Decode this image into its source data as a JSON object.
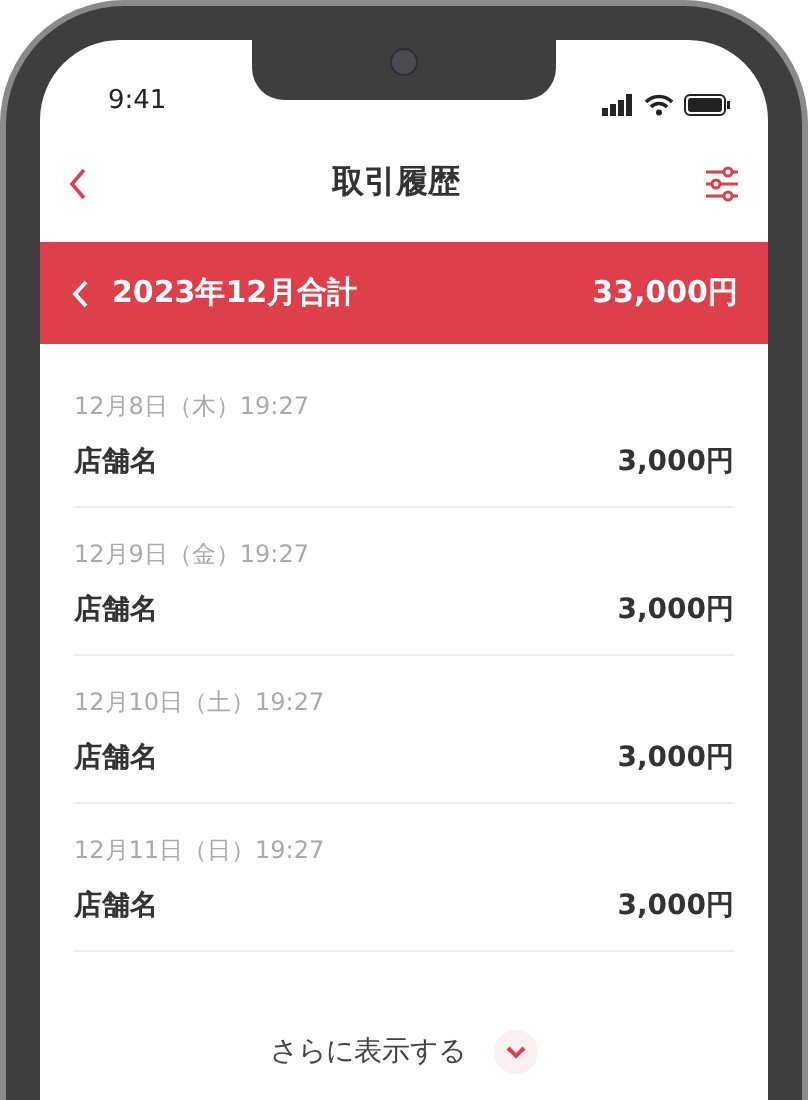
{
  "status_bar": {
    "time": "9:41"
  },
  "header": {
    "title": "取引履歴"
  },
  "month_summary": {
    "label": "2023年12月合計",
    "total": "33,000円"
  },
  "transactions": [
    {
      "datetime": "12月8日（木）19:27",
      "store": "店舗名",
      "amount": "3,000円"
    },
    {
      "datetime": "12月9日（金）19:27",
      "store": "店舗名",
      "amount": "3,000円"
    },
    {
      "datetime": "12月10日（土）19:27",
      "store": "店舗名",
      "amount": "3,000円"
    },
    {
      "datetime": "12月11日（日）19:27",
      "store": "店舗名",
      "amount": "3,000円"
    }
  ],
  "show_more": {
    "label": "さらに表示する"
  }
}
